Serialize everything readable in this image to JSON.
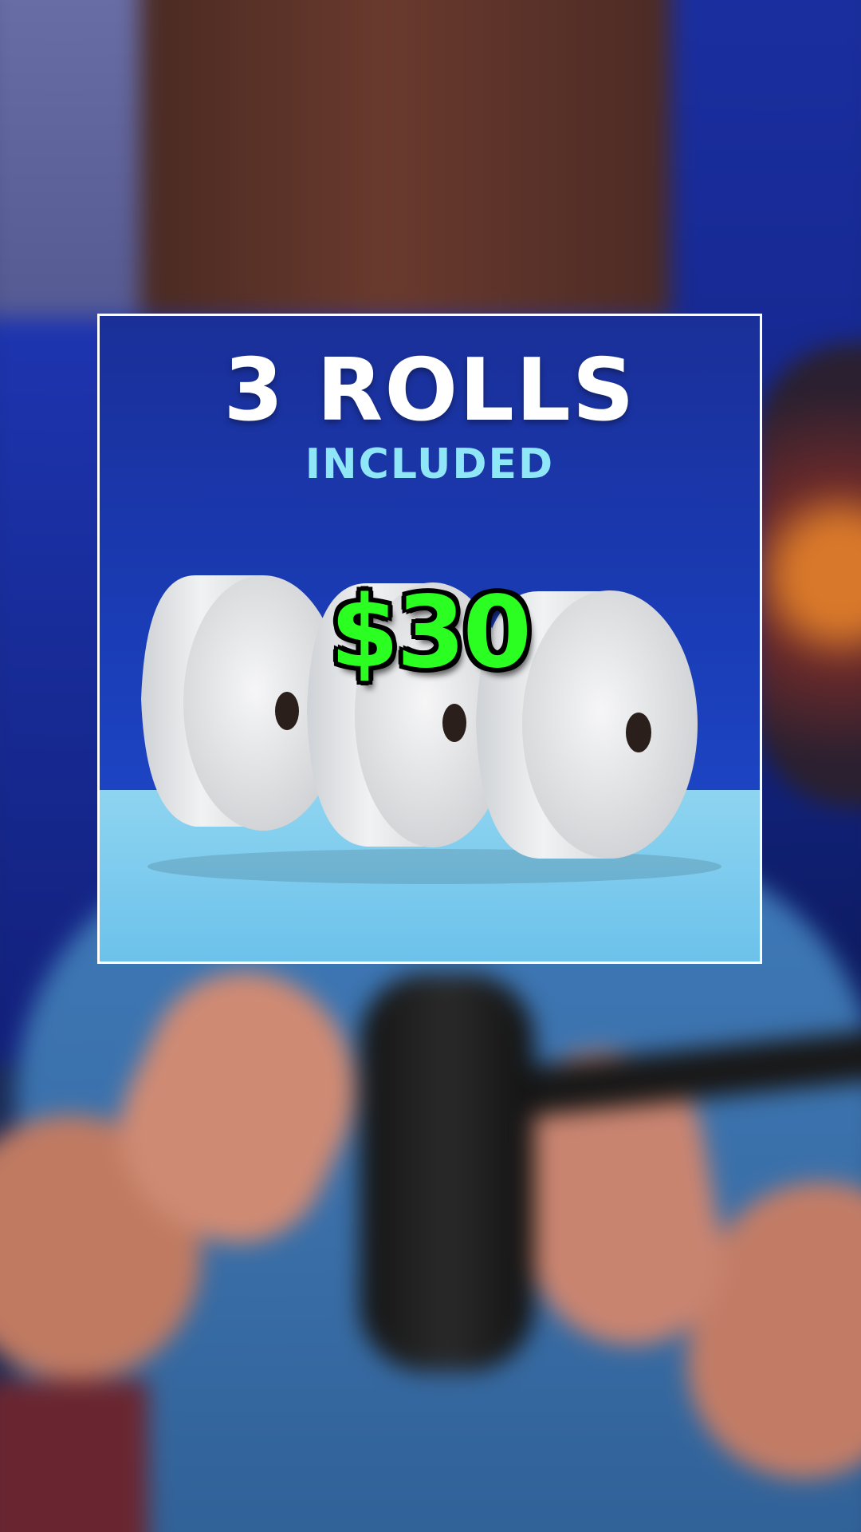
{
  "product_card": {
    "title": "3 ROLLS",
    "subtitle": "INCLUDED",
    "price": "$30",
    "colors": {
      "background": "#1a3bb4",
      "table": "#6cc2eb",
      "subtitle": "#8fe6f6",
      "price": "#2bff22",
      "border": "#ffffff"
    },
    "icons": [
      "toilet-paper-roll-icon",
      "toilet-paper-roll-icon",
      "toilet-paper-roll-icon"
    ]
  }
}
